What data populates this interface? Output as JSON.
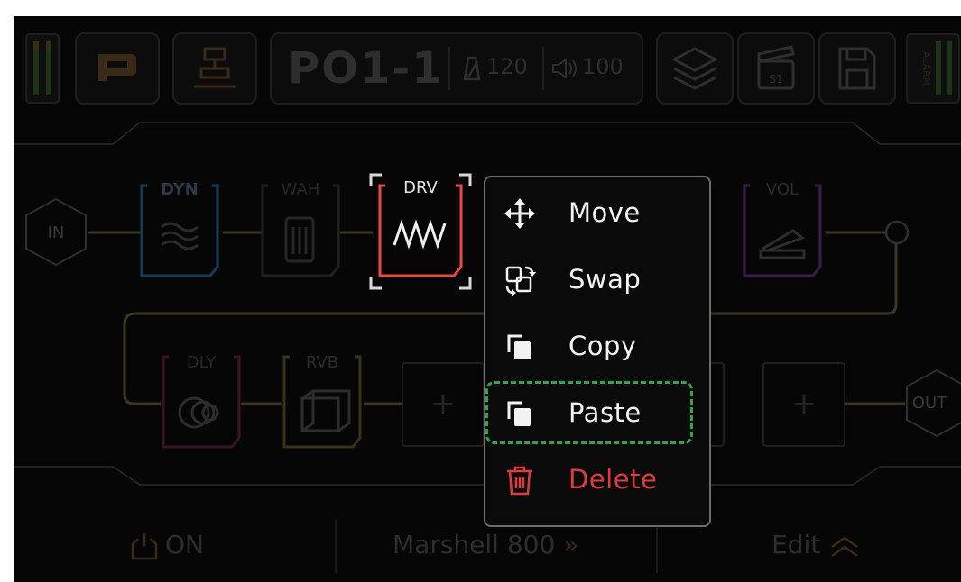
{
  "header": {
    "preset_name": "PO1-1",
    "tempo": "120",
    "volume": "100",
    "scene_badge": "S1",
    "battery_label": "ALARM"
  },
  "chain": {
    "input_label": "IN",
    "output_label": "OUT",
    "blocks": {
      "dyn": "DYN",
      "wah": "WAH",
      "drv": "DRV",
      "vol": "VOL",
      "dly": "DLY",
      "rvb": "RVB"
    },
    "empty_slot": "+"
  },
  "context_menu": {
    "items": [
      {
        "label": "Move",
        "icon": "move-arrows-icon"
      },
      {
        "label": "Swap",
        "icon": "swap-icon"
      },
      {
        "label": "Copy",
        "icon": "copy-icon"
      },
      {
        "label": "Paste",
        "icon": "paste-icon"
      },
      {
        "label": "Delete",
        "icon": "trash-icon"
      }
    ],
    "selected": "Paste"
  },
  "footer": {
    "power_label": "ON",
    "amp_model": "Marshell 800",
    "amp_arrow": "»",
    "edit_label": "Edit"
  },
  "colors": {
    "brand_orange": "#f08a24",
    "drv_red": "#f04545",
    "delete_red": "#e03c3c",
    "selection_green": "#2aa84a",
    "dyn_blue": "#2c87c8",
    "vol_purple": "#8a3fb0",
    "dly_pink": "#c83c6a",
    "rvb_yellow": "#c8a83c"
  }
}
